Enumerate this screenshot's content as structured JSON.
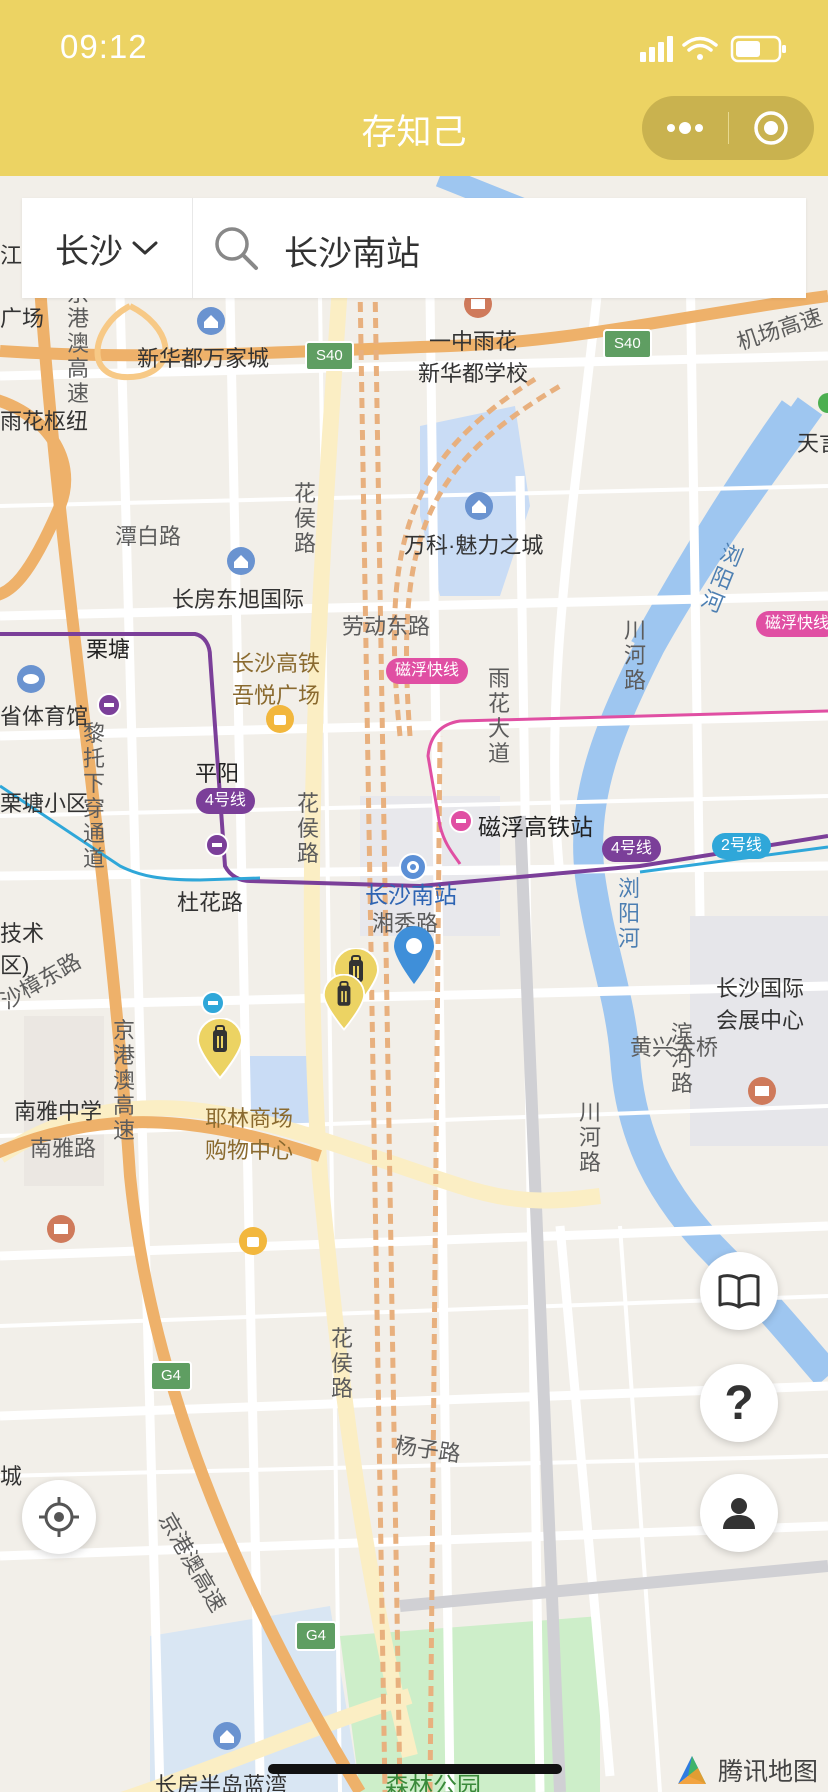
{
  "status_bar": {
    "time": "09:12"
  },
  "nav": {
    "title": "存知己"
  },
  "search": {
    "city": "长沙",
    "query": "长沙南站"
  },
  "map": {
    "road_labels": {
      "jinggang_1": "京港澳高速",
      "jinggang_2": "京港澳高速",
      "jinggang_3": "京港澳高速",
      "airport_exp": "机场高速",
      "s40_a": "S40",
      "s40_b": "S40",
      "g4_a": "G4",
      "g4_b": "G4",
      "tanbai": "潭白路",
      "huahou_1": "花侯路",
      "huahou_2": "花侯路",
      "huahou_3": "花侯路",
      "laodong": "劳动东路",
      "chuanhe_1": "川河路",
      "chuanhe_2": "川河路",
      "yuhua_dadao": "雨花大道",
      "litou": "黎托下穿通道",
      "shazhang": "沙樟东路",
      "xiangxiu": "湘秀路",
      "binhe": "滨河路",
      "nanya_rd": "南雅路",
      "yangzi": "杨子路",
      "huangxing_bridge": "黄兴大桥",
      "du_rd": "杜花路"
    },
    "river_labels": {
      "liuyang_1": "浏阳河",
      "liuyang_2": "浏阳河"
    },
    "poi_labels": {
      "yizhong": "一中雨花\n新华都学校",
      "xinhuadu": "新华都万家城",
      "yuhua_hub": "雨花枢纽",
      "guangchang": "广场",
      "wanke": "万科·魅力之城",
      "changfang": "长房东旭国际",
      "gaotie_plaza": "长沙高铁\n吾悦广场",
      "sports": "省体育馆",
      "litang_xiaoqu": "栗塘小区",
      "changsha_south": "长沙南站",
      "cifu_station": "磁浮高铁站",
      "expo": "长沙国际\n会展中心",
      "nanya_school": "南雅中学",
      "yelin": "耶林商场\n购物中心",
      "tianyi": "天言",
      "jiangcheng": "江",
      "jishu": "技术\n区)",
      "cheng": "城",
      "bandao": "长房半岛蓝湾",
      "senlin": "森林公园"
    },
    "metro_labels": {
      "litang": "栗塘",
      "pingyang": "平阳"
    },
    "metro_badges": {
      "line4_a": "4号线",
      "line4_b": "4号线",
      "line2": "2号线",
      "maglev_a": "磁浮快线",
      "maglev_b": "磁浮快线"
    },
    "markers": [
      {
        "name": "luggage-marker",
        "kind": "locker"
      },
      {
        "name": "luggage-marker",
        "kind": "locker"
      },
      {
        "name": "luggage-marker",
        "kind": "locker"
      },
      {
        "name": "destination-pin",
        "kind": "selected-location"
      }
    ]
  },
  "controls": {
    "help": "?"
  },
  "brand": {
    "text": "腾讯地图"
  },
  "colors": {
    "header": "#ecd363",
    "metro_line4": "#7b3f99",
    "metro_line2": "#2fa7d9",
    "maglev": "#e04fa3",
    "river": "#9ec6f0",
    "expressway": "#eeb16a"
  }
}
